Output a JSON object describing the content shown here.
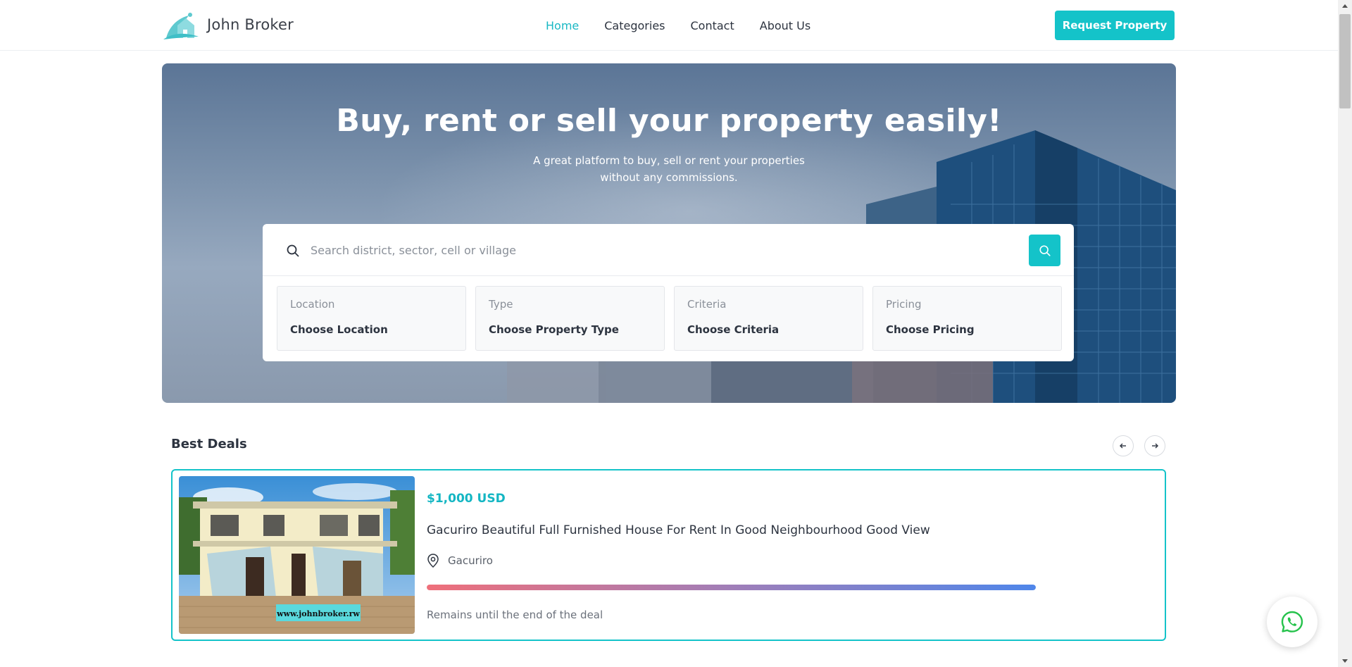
{
  "navbar": {
    "brand_name": "John Broker",
    "links": [
      {
        "label": "Home",
        "active": true
      },
      {
        "label": "Categories",
        "active": false
      },
      {
        "label": "Contact",
        "active": false
      },
      {
        "label": "About Us",
        "active": false
      }
    ],
    "cta_label": "Request Property"
  },
  "hero": {
    "title": "Buy, rent or sell your property easily!",
    "subtitle_line1": "A great platform to buy, sell or rent your properties",
    "subtitle_line2": "without any commissions."
  },
  "search": {
    "placeholder": "Search district, sector, cell or village",
    "value": "",
    "filters": [
      {
        "label": "Location",
        "value": "Choose Location"
      },
      {
        "label": "Type",
        "value": "Choose Property Type"
      },
      {
        "label": "Criteria",
        "value": "Choose Criteria"
      },
      {
        "label": "Pricing",
        "value": "Choose Pricing"
      }
    ]
  },
  "best_deals": {
    "title": "Best Deals",
    "deal": {
      "price": "$1,000 USD",
      "title": "Gacuriro Beautiful Full Furnished House For Rent In Good Neighbourhood Good View",
      "location": "Gacuriro",
      "watermark": "www.johnbroker.rw",
      "progress_fraction": 1.0,
      "remain_text": "Remains until the end of the deal"
    }
  },
  "colors": {
    "accent": "#14c3c9",
    "price": "#14b6c3",
    "progress_start": "#ef6f7a",
    "progress_end": "#4f86ea"
  },
  "icons": {
    "search": "search-icon",
    "prev": "arrow-left-icon",
    "next": "arrow-right-icon",
    "location": "map-pin-icon",
    "whatsapp": "whatsapp-icon"
  }
}
